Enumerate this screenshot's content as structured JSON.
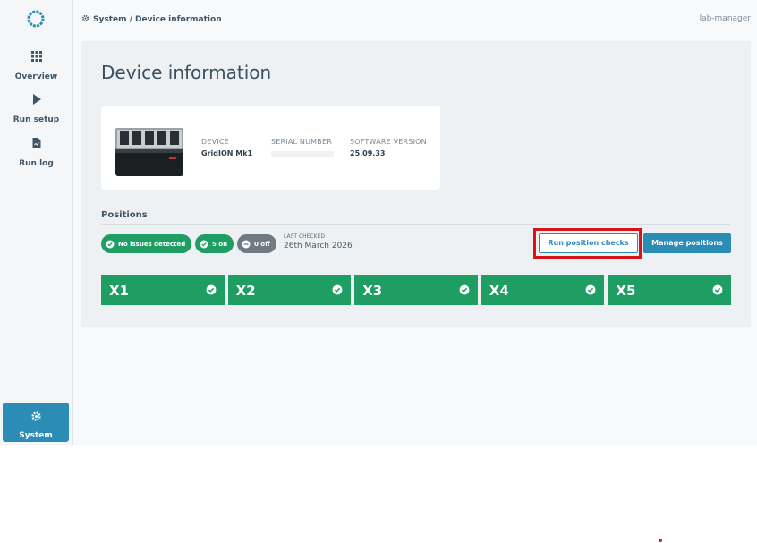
{
  "sidebar": {
    "items": [
      {
        "label": "Overview",
        "icon": "grid-icon"
      },
      {
        "label": "Run setup",
        "icon": "play-icon"
      },
      {
        "label": "Run log",
        "icon": "document-icon"
      }
    ],
    "system_label": "System",
    "system_icon": "gear-icon"
  },
  "header": {
    "breadcrumb": "System / Device information",
    "user": "lab-manager"
  },
  "page": {
    "title": "Device information"
  },
  "device": {
    "device_label": "DEVICE",
    "device_value": "GridION Mk1",
    "serial_label": "SERIAL NUMBER",
    "serial_value": "",
    "software_label": "SOFTWARE VERSION",
    "software_value": "25.09.33"
  },
  "positions_section": {
    "title": "Positions",
    "status_pills": [
      {
        "label": "No issues detected",
        "color": "#1e9e62",
        "icon": "check-circle-icon"
      },
      {
        "label": "5 on",
        "color": "#1e9e62",
        "icon": "check-circle-icon"
      },
      {
        "label": "0 off",
        "color": "#6f7a82",
        "icon": "minus-circle-icon"
      }
    ],
    "last_checked_label": "LAST CHECKED",
    "last_checked_value": "26th March 2026",
    "run_checks_label": "Run position checks",
    "manage_label": "Manage positions",
    "positions": [
      {
        "name": "X1",
        "status": "ok"
      },
      {
        "name": "X2",
        "status": "ok"
      },
      {
        "name": "X3",
        "status": "ok"
      },
      {
        "name": "X4",
        "status": "ok"
      },
      {
        "name": "X5",
        "status": "ok"
      }
    ]
  },
  "colors": {
    "accent": "#2b8db5",
    "success": "#1e9e62",
    "neutral": "#6f7a82",
    "highlight": "#d6151b"
  }
}
